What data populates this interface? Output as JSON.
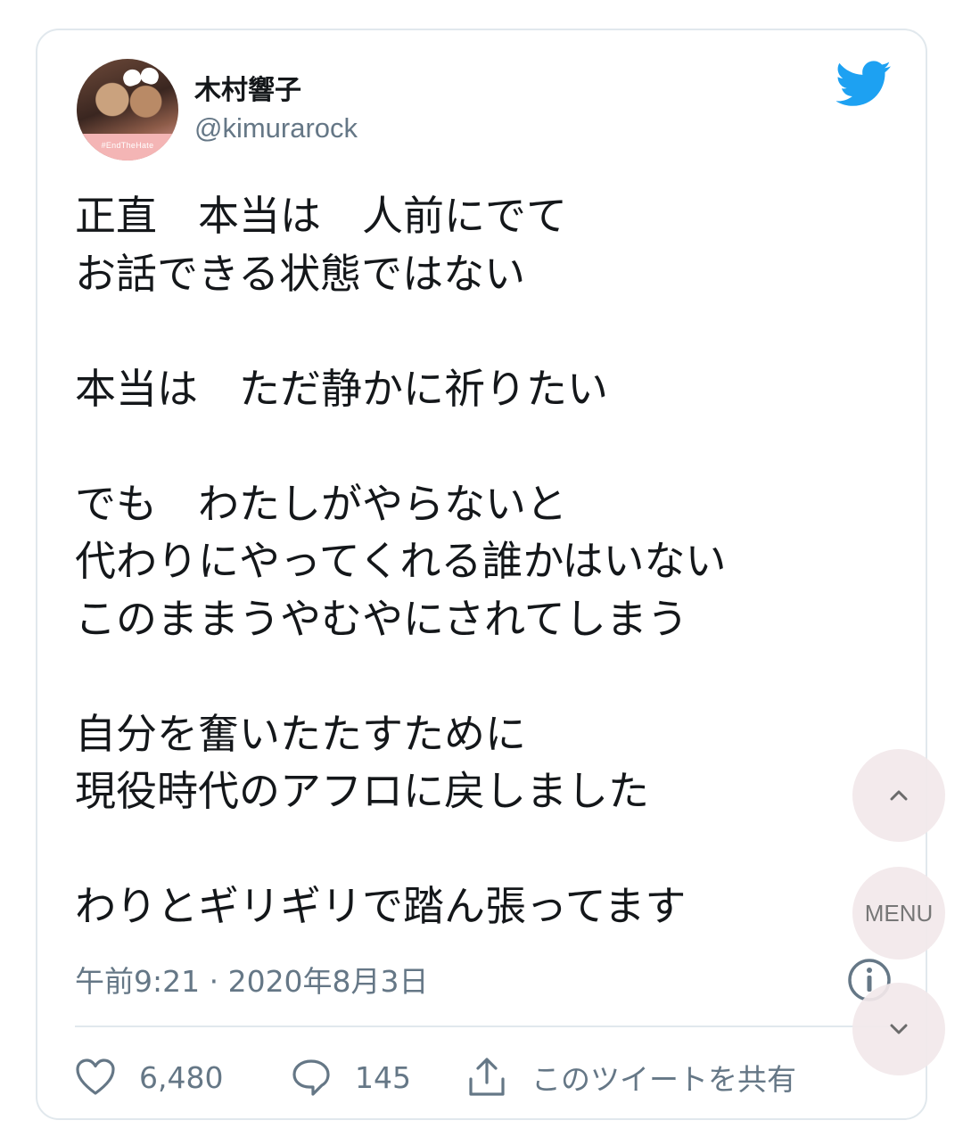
{
  "author": {
    "name": "木村響子",
    "handle": "@kimurarock",
    "avatar_badge": "#EndTheHate"
  },
  "tweet": {
    "lines": [
      "正直　本当は　人前にでて",
      "お話できる状態ではない",
      "",
      "本当は　ただ静かに祈りたい",
      "",
      "でも　わたしがやらないと",
      "代わりにやってくれる誰かはいない",
      "このままうやむやにされてしまう",
      "",
      "自分を奮いたたすために",
      "現役時代のアフロに戻しました",
      "",
      "わりとギリギリで踏ん張ってます"
    ],
    "timestamp": "午前9:21 · 2020年8月3日"
  },
  "actions": {
    "likes": "6,480",
    "replies": "145",
    "share_label": "このツイートを共有"
  },
  "floating": {
    "menu_label": "MENU"
  },
  "icons": {
    "logo": "twitter-bird-icon",
    "info": "info-icon",
    "like": "heart-icon",
    "reply": "speech-bubble-icon",
    "share": "share-icon",
    "up": "chevron-up-icon",
    "down": "chevron-down-icon"
  },
  "colors": {
    "twitter_blue": "#1da1f2",
    "text": "#14171a",
    "secondary_text": "#657786",
    "border": "#e1e8ed",
    "floating_button": "#f2e8ea"
  }
}
